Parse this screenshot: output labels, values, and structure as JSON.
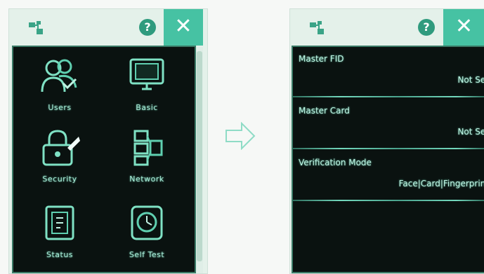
{
  "colors": {
    "accent": "#46c2a3",
    "help_bg": "#2f9b7e",
    "panel_bg": "#e4f1ea",
    "screen_bg": "#0a1210",
    "screen_text": "#bff2e2"
  },
  "left_panel": {
    "titlebar": {
      "app_icon": "app-icon",
      "help_label": "?",
      "close_label": "✕"
    },
    "tiles": [
      {
        "label": "Users",
        "icon": "users-icon"
      },
      {
        "label": "Basic",
        "icon": "monitor-icon"
      },
      {
        "label": "Security",
        "icon": "lock-icon"
      },
      {
        "label": "Network",
        "icon": "network-icon"
      },
      {
        "label": "Status",
        "icon": "status-icon"
      },
      {
        "label": "Self Test",
        "icon": "self-test-icon"
      }
    ]
  },
  "arrow": {
    "icon": "arrow-right-icon"
  },
  "right_panel": {
    "titlebar": {
      "app_icon": "app-icon",
      "help_label": "?",
      "close_label": "✕"
    },
    "rows": [
      {
        "title": "Master FID",
        "value": "Not Set"
      },
      {
        "title": "Master Card",
        "value": "Not Set"
      },
      {
        "title": "Verification Mode",
        "value": "Face|Card|Fingerprint"
      }
    ]
  }
}
